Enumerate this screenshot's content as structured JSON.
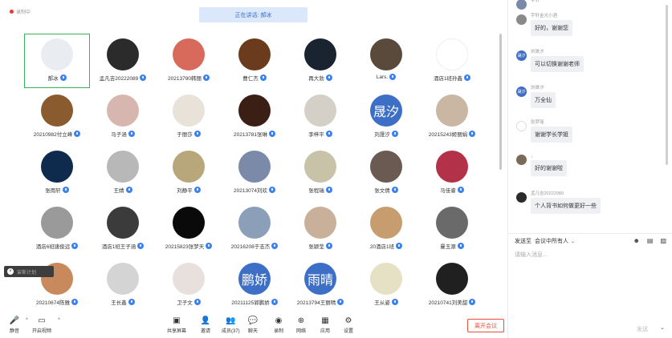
{
  "recording": {
    "label": "录制中"
  },
  "speaking_banner": "正在讲话: 郝冰",
  "participants": [
    {
      "name": "郝冰",
      "color": "#e9edf2",
      "text": "",
      "active": true
    },
    {
      "name": "孟凡吉20222089",
      "color": "#2b2b2b",
      "text": ""
    },
    {
      "name": "20213790韩丽",
      "color": "#d86a5b",
      "text": ""
    },
    {
      "name": "曹仁杰",
      "color": "#6b3b1e",
      "text": ""
    },
    {
      "name": "再大勃",
      "color": "#1a2330",
      "text": ""
    },
    {
      "name": "Lars.",
      "color": "#5a4a3c",
      "text": ""
    },
    {
      "name": "酒店1班孙鑫",
      "color": "#ffffff",
      "text": ""
    },
    {
      "name": "20210982付立峰",
      "color": "#8a5b2e",
      "text": ""
    },
    {
      "name": "马子涵",
      "color": "#d8b6b0",
      "text": ""
    },
    {
      "name": "于丽莎",
      "color": "#e8e2d8",
      "text": ""
    },
    {
      "name": "20213781张琳",
      "color": "#3b1f14",
      "text": ""
    },
    {
      "name": "李梓平",
      "color": "#d4d0c8",
      "text": ""
    },
    {
      "name": "刘晟汐",
      "color": "#3d6fc6",
      "text": "晟汐"
    },
    {
      "name": "20215243姬丽娟",
      "color": "#c9b7a4",
      "text": ""
    },
    {
      "name": "张雨轩",
      "color": "#0e2a4d",
      "text": ""
    },
    {
      "name": "王婧",
      "color": "#b8b8b8",
      "text": ""
    },
    {
      "name": "刘静平",
      "color": "#b8a77a",
      "text": ""
    },
    {
      "name": "20213074刘欢",
      "color": "#7a8aa8",
      "text": ""
    },
    {
      "name": "张程瑞",
      "color": "#c8c2a8",
      "text": ""
    },
    {
      "name": "张文倩",
      "color": "#6b5a52",
      "text": ""
    },
    {
      "name": "马佳睿",
      "color": "#b3324a",
      "text": ""
    },
    {
      "name": "酒店6班唐俊远",
      "color": "#9a9a9a",
      "text": ""
    },
    {
      "name": "酒店1班王子涵",
      "color": "#3b3b3b",
      "text": ""
    },
    {
      "name": "20215823张梦天",
      "color": "#0a0a0a",
      "text": ""
    },
    {
      "name": "20216208于志杰",
      "color": "#8ba0b8",
      "text": ""
    },
    {
      "name": "张颖莹",
      "color": "#c8b09a",
      "text": ""
    },
    {
      "name": "20酒店1班",
      "color": "#c79c6e",
      "text": ""
    },
    {
      "name": "曼玉源",
      "color": "#6a6a6a",
      "text": ""
    },
    {
      "name": "20210674陈雅",
      "color": "#c88a5c",
      "text": ""
    },
    {
      "name": "王长鑫",
      "color": "#d4d4d4",
      "text": ""
    },
    {
      "name": "卫子文",
      "color": "#e8e0dc",
      "text": ""
    },
    {
      "name": "20211125郭鹏娇",
      "color": "#3d6fc6",
      "text": "鹏娇"
    },
    {
      "name": "20213794王丽晴",
      "color": "#3d6fc6",
      "text": "雨晴"
    },
    {
      "name": "王从姿",
      "color": "#e6e0c4",
      "text": ""
    },
    {
      "name": "20210741刘美甜",
      "color": "#202020",
      "text": ""
    }
  ],
  "pill": {
    "text": "宙斯计划"
  },
  "toolbar": [
    {
      "label": "静音",
      "icon": "mic-icon",
      "glyph": "🎤"
    },
    {
      "label": "开启视频",
      "icon": "camera-icon",
      "glyph": "▭"
    },
    {
      "label": "共享屏幕",
      "icon": "screen-share-icon",
      "glyph": "▣"
    },
    {
      "label": "邀请",
      "icon": "invite-icon",
      "glyph": "👤"
    },
    {
      "label": "成员(37)",
      "icon": "members-icon",
      "glyph": "👥"
    },
    {
      "label": "聊天",
      "icon": "chat-icon",
      "glyph": "💬"
    },
    {
      "label": "录制",
      "icon": "record-icon",
      "glyph": "◉"
    },
    {
      "label": "网络",
      "icon": "network-icon",
      "glyph": "⊕"
    },
    {
      "label": "应用",
      "icon": "apps-icon",
      "glyph": "▦"
    },
    {
      "label": "设置",
      "icon": "settings-icon",
      "glyph": "⚙"
    }
  ],
  "leave_label": "离开会议",
  "chat": {
    "messages": [
      {
        "sender": "宇轩",
        "text": "",
        "color": "#7a8aa8",
        "initials": ""
      },
      {
        "sender": "宇轩金光小酒",
        "text": "好的，谢谢您",
        "color": "#8a8a8a",
        "initials": ""
      },
      {
        "sender": "刘晟汐",
        "text": "可以切换谢谢老师",
        "color": "#3d6fc6",
        "initials": "晟汐"
      },
      {
        "sender": "刘晟汐",
        "text": "万全仙",
        "color": "#3d6fc6",
        "initials": "晟汐"
      },
      {
        "sender": "张梦瑶",
        "text": "谢谢学长学姐",
        "color": "#ffffff",
        "initials": ""
      },
      {
        "sender": "，",
        "text": "好的谢谢啦",
        "color": "#7a6a5a",
        "initials": ""
      },
      {
        "sender": "孟凡吉20222089",
        "text": "个人背书如何做更好一些",
        "color": "#2b2b2b",
        "initials": ""
      }
    ],
    "send_to_label": "发送至",
    "send_to_value": "会议中所有人",
    "input_placeholder": "请输入消息...",
    "send_button": "发送"
  }
}
